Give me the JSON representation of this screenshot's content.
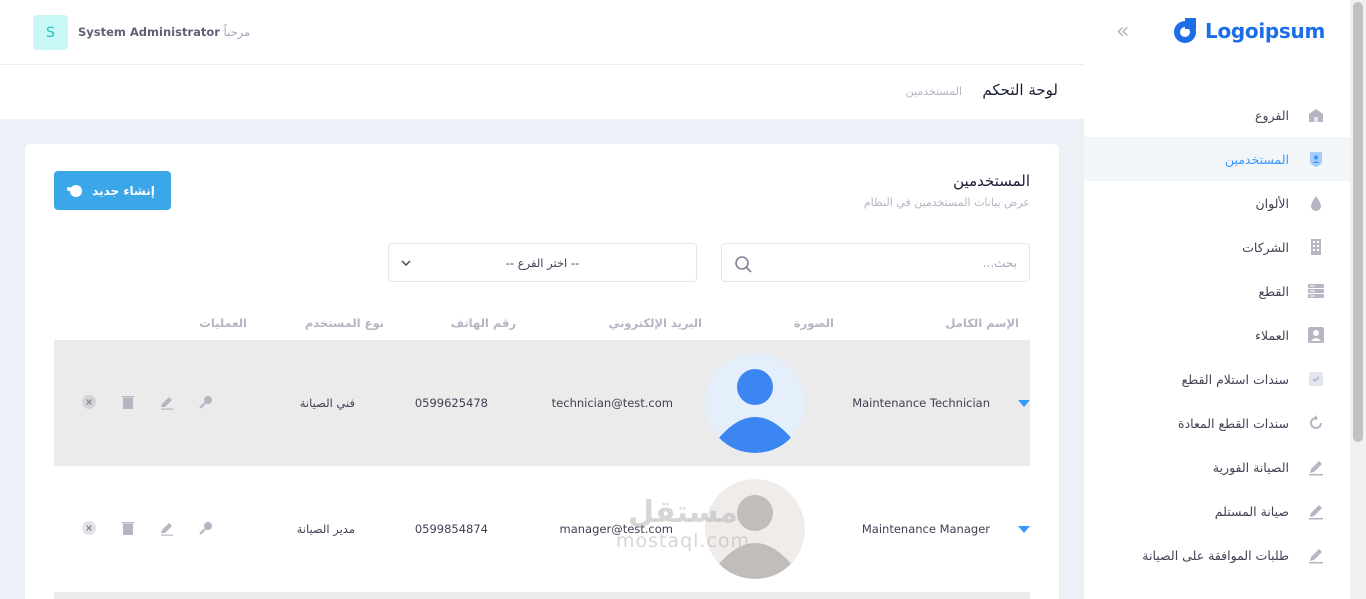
{
  "header": {
    "avatar_letter": "S",
    "greeting": "مرحباً",
    "user_name": "System Administrator"
  },
  "subheader": {
    "title": "لوحة التحكم",
    "breadcrumb": "المستخدمين"
  },
  "brand": {
    "logo_text": "Logoipsum",
    "color": "#1c6ee8"
  },
  "sidebar": {
    "items": [
      {
        "label": "الفروع",
        "icon": "home-icon",
        "active": false
      },
      {
        "label": "المستخدمين",
        "icon": "user-shield-icon",
        "active": true
      },
      {
        "label": "الألوان",
        "icon": "drop-icon",
        "active": false
      },
      {
        "label": "الشركات",
        "icon": "building-icon",
        "active": false
      },
      {
        "label": "القطع",
        "icon": "server-icon",
        "active": false
      },
      {
        "label": "العملاء",
        "icon": "user-card-icon",
        "active": false
      },
      {
        "label": "سندات استلام القطع",
        "icon": "check-doc-icon",
        "active": false
      },
      {
        "label": "سندات القطع المعادة",
        "icon": "refresh-icon",
        "active": false
      },
      {
        "label": "الصيانة الفورية",
        "icon": "pencil-icon",
        "active": false
      },
      {
        "label": "صيانة المستلم",
        "icon": "pencil-icon",
        "active": false
      },
      {
        "label": "طلبات الموافقة على الصيانة",
        "icon": "pencil-icon",
        "active": false
      }
    ]
  },
  "card": {
    "title": "المستخدمين",
    "subtitle": "عرض بيانات المستخدمين في النظام",
    "new_button": "إنشاء جديد",
    "search_placeholder": "بحث...",
    "branch_select": "-- اختر الفرع --"
  },
  "table": {
    "headers": {
      "full_name": "الإسم الكامل",
      "photo": "الصورة",
      "email": "البريد الإلكتروني",
      "phone": "رقم الهاتف",
      "user_type": "نوع المستخدم",
      "actions": "العمليات"
    },
    "rows": [
      {
        "full_name": "Maintenance Technician",
        "email": "technician@test.com",
        "phone": "0599625478",
        "user_type": "فني الصيانة"
      },
      {
        "full_name": "Maintenance Manager",
        "email": "manager@test.com",
        "phone": "0599854874",
        "user_type": "مدير الصيانة"
      }
    ]
  },
  "watermark": {
    "arabic": "مستقل",
    "latin": "mostaql.com"
  },
  "colors": {
    "primary": "#3699ff",
    "button": "#3ca7e8",
    "row_highlight": "#ebebeb"
  }
}
